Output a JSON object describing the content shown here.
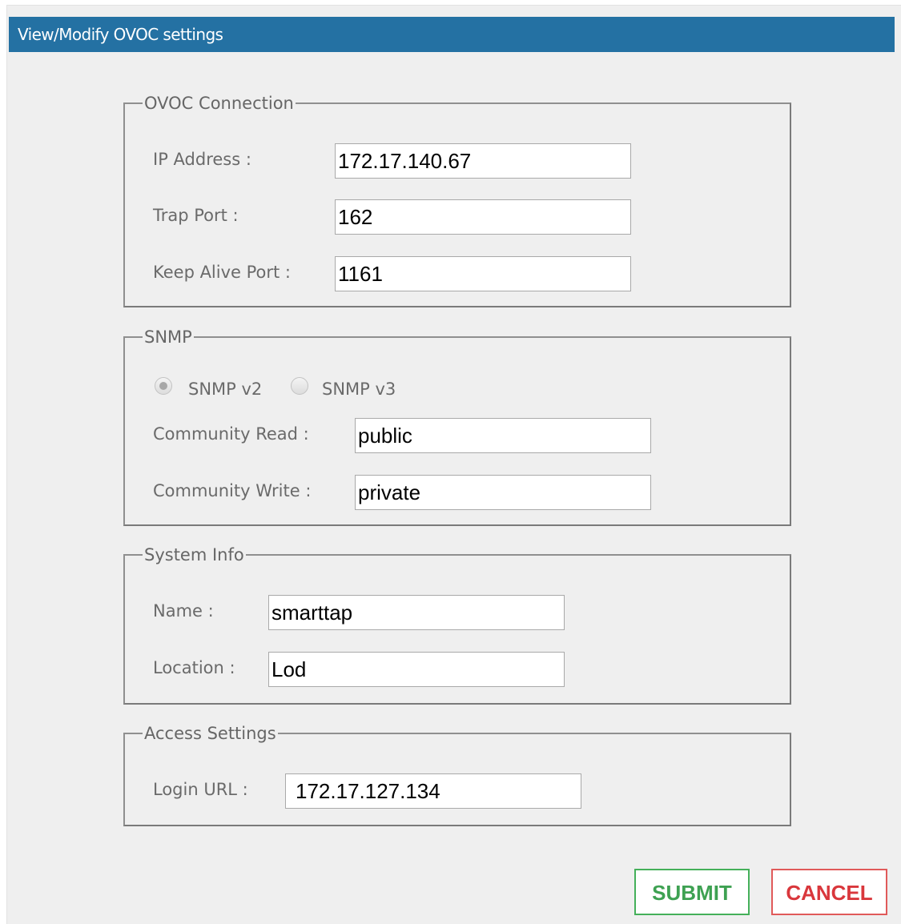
{
  "dialog": {
    "title": "View/Modify OVOC settings"
  },
  "ovoc_connection": {
    "legend": "OVOC Connection",
    "ip_address": {
      "label": "IP Address :",
      "value": "172.17.140.67"
    },
    "trap_port": {
      "label": "Trap Port :",
      "value": "162"
    },
    "keep_alive_port": {
      "label": "Keep Alive Port :",
      "value": "1161"
    }
  },
  "snmp": {
    "legend": "SNMP",
    "options": [
      {
        "label": "SNMP v2",
        "selected": true
      },
      {
        "label": "SNMP v3",
        "selected": false
      }
    ],
    "community_read": {
      "label": "Community Read :",
      "value": "public"
    },
    "community_write": {
      "label": "Community Write :",
      "value": "private"
    }
  },
  "system_info": {
    "legend": "System Info",
    "name": {
      "label": "Name :",
      "value": "smarttap"
    },
    "location": {
      "label": "Location :",
      "value": "Lod"
    }
  },
  "access_settings": {
    "legend": "Access Settings",
    "login_url": {
      "label": "Login URL :",
      "value": "172.17.127.134"
    }
  },
  "buttons": {
    "submit": "SUBMIT",
    "cancel": "CANCEL"
  },
  "colors": {
    "title_bar": "#2471a3",
    "background": "#efefef",
    "submit": "#3ea152",
    "cancel": "#d9373c"
  }
}
